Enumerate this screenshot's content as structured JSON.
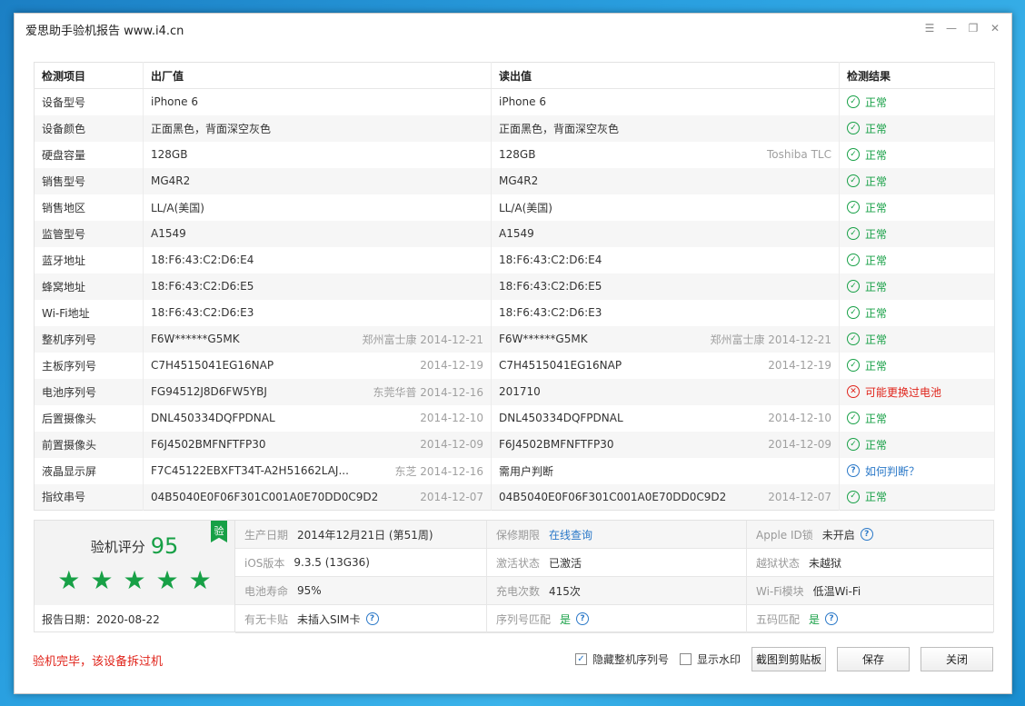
{
  "window": {
    "title": "爱思助手验机报告 www.i4.cn"
  },
  "table": {
    "headers": [
      "检测项目",
      "出厂值",
      "读出值",
      "检测结果"
    ],
    "rows": [
      {
        "item": "设备型号",
        "factory": "iPhone 6",
        "factory_sub": "",
        "read": "iPhone 6",
        "read_sub": "",
        "result": "正常",
        "status": "ok"
      },
      {
        "item": "设备颜色",
        "factory": "正面黑色，背面深空灰色",
        "factory_sub": "",
        "read": "正面黑色，背面深空灰色",
        "read_sub": "",
        "result": "正常",
        "status": "ok"
      },
      {
        "item": "硬盘容量",
        "factory": "128GB",
        "factory_sub": "",
        "read": "128GB",
        "read_sub": "Toshiba TLC",
        "result": "正常",
        "status": "ok"
      },
      {
        "item": "销售型号",
        "factory": "MG4R2",
        "factory_sub": "",
        "read": "MG4R2",
        "read_sub": "",
        "result": "正常",
        "status": "ok"
      },
      {
        "item": "销售地区",
        "factory": "LL/A(美国)",
        "factory_sub": "",
        "read": "LL/A(美国)",
        "read_sub": "",
        "result": "正常",
        "status": "ok"
      },
      {
        "item": "监管型号",
        "factory": "A1549",
        "factory_sub": "",
        "read": "A1549",
        "read_sub": "",
        "result": "正常",
        "status": "ok"
      },
      {
        "item": "蓝牙地址",
        "factory": "18:F6:43:C2:D6:E4",
        "factory_sub": "",
        "read": "18:F6:43:C2:D6:E4",
        "read_sub": "",
        "result": "正常",
        "status": "ok"
      },
      {
        "item": "蜂窝地址",
        "factory": "18:F6:43:C2:D6:E5",
        "factory_sub": "",
        "read": "18:F6:43:C2:D6:E5",
        "read_sub": "",
        "result": "正常",
        "status": "ok"
      },
      {
        "item": "Wi-Fi地址",
        "factory": "18:F6:43:C2:D6:E3",
        "factory_sub": "",
        "read": "18:F6:43:C2:D6:E3",
        "read_sub": "",
        "result": "正常",
        "status": "ok"
      },
      {
        "item": "整机序列号",
        "factory": "F6W******G5MK",
        "factory_sub": "郑州富士康 2014-12-21",
        "read": "F6W******G5MK",
        "read_sub": "郑州富士康 2014-12-21",
        "result": "正常",
        "status": "ok"
      },
      {
        "item": "主板序列号",
        "factory": "C7H4515041EG16NAP",
        "factory_sub": "2014-12-19",
        "read": "C7H4515041EG16NAP",
        "read_sub": "2014-12-19",
        "result": "正常",
        "status": "ok"
      },
      {
        "item": "电池序列号",
        "factory": "FG94512J8D6FW5YBJ",
        "factory_sub": "东莞华普 2014-12-16",
        "read": "201710",
        "read_sub": "",
        "result": "可能更换过电池",
        "status": "bad"
      },
      {
        "item": "后置摄像头",
        "factory": "DNL450334DQFPDNAL",
        "factory_sub": "2014-12-10",
        "read": "DNL450334DQFPDNAL",
        "read_sub": "2014-12-10",
        "result": "正常",
        "status": "ok"
      },
      {
        "item": "前置摄像头",
        "factory": "F6J4502BMFNFTFP30",
        "factory_sub": "2014-12-09",
        "read": "F6J4502BMFNFTFP30",
        "read_sub": "2014-12-09",
        "result": "正常",
        "status": "ok"
      },
      {
        "item": "液晶显示屏",
        "factory": "F7C45122EBXFT34T-A2H51662LAJ...",
        "factory_sub": "东芝 2014-12-16",
        "read": "需用户判断",
        "read_sub": "",
        "result": "如何判断？",
        "status": "ask"
      },
      {
        "item": "指纹串号",
        "factory": "04B5040E0F06F301C001A0E70DD0C9D2",
        "factory_sub": "2014-12-07",
        "read": "04B5040E0F06F301C001A0E70DD0C9D2",
        "read_sub": "2014-12-07",
        "result": "正常",
        "status": "ok"
      }
    ]
  },
  "summary": {
    "score_label": "验机评分",
    "score": "95",
    "stars_count": 5,
    "badge": "验",
    "report_date": "报告日期：2020-08-22",
    "cells": [
      {
        "key": "生产日期",
        "value": "2014年12月21日 (第51周)",
        "style": "plain",
        "help": false
      },
      {
        "key": "保修期限",
        "value": "在线查询",
        "style": "link",
        "help": false
      },
      {
        "key": "Apple ID锁",
        "value": "未开启",
        "style": "plain",
        "help": true
      },
      {
        "key": "iOS版本",
        "value": "9.3.5 (13G36)",
        "style": "plain",
        "help": false
      },
      {
        "key": "激活状态",
        "value": "已激活",
        "style": "plain",
        "help": false
      },
      {
        "key": "越狱状态",
        "value": "未越狱",
        "style": "plain",
        "help": false
      },
      {
        "key": "电池寿命",
        "value": "95%",
        "style": "plain",
        "help": false
      },
      {
        "key": "充电次数",
        "value": "415次",
        "style": "plain",
        "help": false
      },
      {
        "key": "Wi-Fi模块",
        "value": "低温Wi-Fi",
        "style": "plain",
        "help": false
      },
      {
        "key": "有无卡贴",
        "value": "未插入SIM卡",
        "style": "plain",
        "help": true
      },
      {
        "key": "序列号匹配",
        "value": "是",
        "style": "green",
        "help": true
      },
      {
        "key": "五码匹配",
        "value": "是",
        "style": "green",
        "help": true
      }
    ]
  },
  "footer": {
    "status_message": "验机完毕，该设备拆过机",
    "hide_serial_label": "隐藏整机序列号",
    "hide_serial_checked": true,
    "watermark_label": "显示水印",
    "watermark_checked": false,
    "screenshot_button": "截图到剪贴板",
    "save_button": "保存",
    "close_button": "关闭"
  },
  "colors": {
    "ok": "#17a046",
    "bad": "#e0241b",
    "link": "#2a78c8"
  }
}
